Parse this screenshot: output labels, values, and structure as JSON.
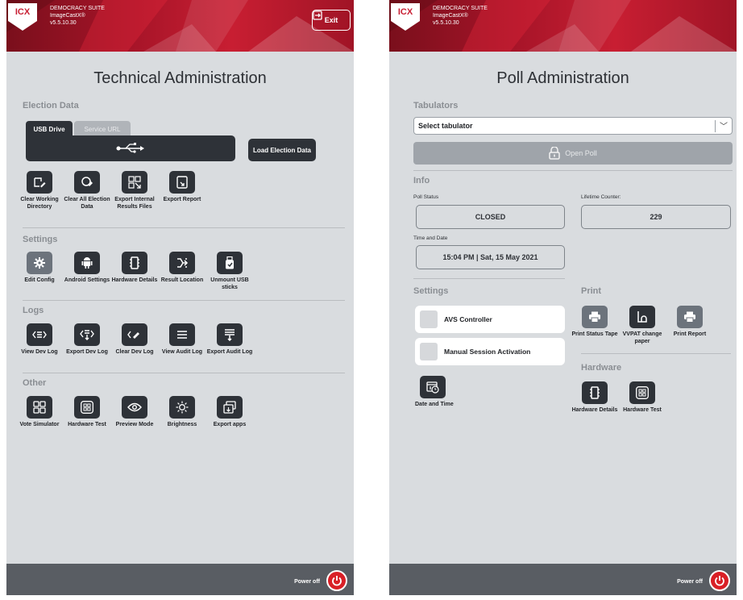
{
  "header": {
    "logo_text": "ICX",
    "suite_name": "DEMOCRACY SUITE",
    "product_name": "ImageCastX®",
    "version": "v5.5.10.30",
    "exit_label": "Exit"
  },
  "footer": {
    "power_off_label": "Power off"
  },
  "technical_admin": {
    "title": "Technical Administration",
    "election_data": {
      "section_label": "Election Data",
      "tabs": [
        "USB Drive",
        "Service URL"
      ],
      "load_button": "Load Election Data",
      "actions": [
        {
          "label": "Clear Working Directory",
          "icon": "clear-folder-icon"
        },
        {
          "label": "Clear All Election Data",
          "icon": "erase-all-icon"
        },
        {
          "label": "Export Internal Results Files",
          "icon": "export-files-icon"
        },
        {
          "label": "Export Report",
          "icon": "export-report-icon"
        }
      ]
    },
    "settings": {
      "section_label": "Settings",
      "actions": [
        {
          "label": "Edit Config",
          "icon": "gear-icon"
        },
        {
          "label": "Android Settings",
          "icon": "android-icon"
        },
        {
          "label": "Hardware Details",
          "icon": "chip-icon"
        },
        {
          "label": "Result Location",
          "icon": "location-arrows-icon"
        },
        {
          "label": "Unmount USB sticks",
          "icon": "usb-stick-icon"
        }
      ]
    },
    "logs": {
      "section_label": "Logs",
      "actions": [
        {
          "label": "View Dev Log",
          "icon": "code-log-icon"
        },
        {
          "label": "Export Dev Log",
          "icon": "export-code-log-icon"
        },
        {
          "label": "Clear Dev Log",
          "icon": "clear-code-log-icon"
        },
        {
          "label": "View Audit Log",
          "icon": "list-icon"
        },
        {
          "label": "Export Audit Log",
          "icon": "export-list-icon"
        }
      ]
    },
    "other": {
      "section_label": "Other",
      "actions": [
        {
          "label": "Vote Simulator",
          "icon": "grid-icon"
        },
        {
          "label": "Hardware Test",
          "icon": "hardware-grid-icon"
        },
        {
          "label": "Preview Mode",
          "icon": "eye-icon"
        },
        {
          "label": "Brightness",
          "icon": "sun-icon"
        },
        {
          "label": "Export apps",
          "icon": "export-apps-icon"
        }
      ]
    }
  },
  "poll_admin": {
    "title": "Poll Administration",
    "tabulators": {
      "section_label": "Tabulators",
      "select_value": "Select tabulator",
      "open_poll_label": "Open Poll"
    },
    "info": {
      "section_label": "Info",
      "poll_status_label": "Poll Status",
      "poll_status_value": "CLOSED",
      "lifetime_counter_label": "Lifetime Counter:",
      "lifetime_counter_value": "229",
      "time_date_label": "Time and Date",
      "time_date_value": "15:04 PM | Sat, 15 May 2021"
    },
    "settings": {
      "section_label": "Settings",
      "avs_controller": "AVS Controller",
      "manual_session": "Manual Session Activation",
      "date_time_label": "Date and Time"
    },
    "print": {
      "section_label": "Print",
      "actions": [
        {
          "label": "Print Status Tape",
          "icon": "printer-icon"
        },
        {
          "label": "VVPAT change paper",
          "icon": "paper-roll-icon"
        },
        {
          "label": "Print Report",
          "icon": "printer-icon"
        }
      ]
    },
    "hardware": {
      "section_label": "Hardware",
      "actions": [
        {
          "label": "Hardware Details",
          "icon": "chip-icon"
        },
        {
          "label": "Hardware Test",
          "icon": "hardware-grid-icon"
        }
      ]
    }
  }
}
